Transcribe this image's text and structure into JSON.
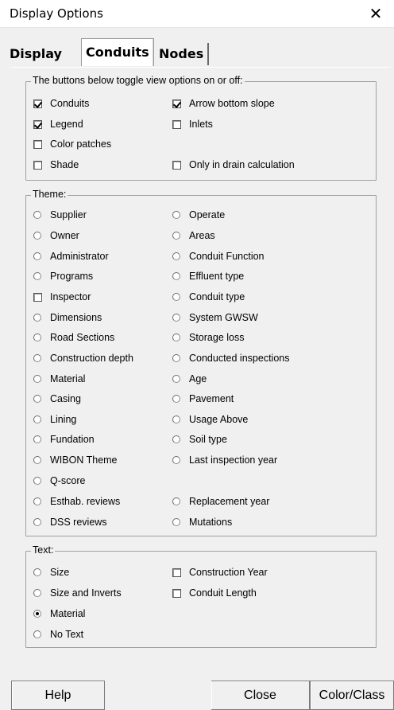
{
  "window": {
    "title": "Display Options",
    "close_glyph": "✕"
  },
  "tabs": [
    {
      "label": "Display",
      "active": false
    },
    {
      "label": "Conduits",
      "active": true
    },
    {
      "label": "Nodes",
      "active": false
    }
  ],
  "toggles": {
    "legend": "The buttons below toggle view options on or off:",
    "items": [
      {
        "label": "Conduits",
        "checked": true
      },
      {
        "label": "Arrow bottom slope",
        "checked": true
      },
      {
        "label": "Legend",
        "checked": true
      },
      {
        "label": "Inlets",
        "checked": false
      },
      {
        "label": "Color patches",
        "checked": false
      },
      {
        "label": "Shade",
        "checked": false
      },
      {
        "label": "Only in drain calculation",
        "checked": false
      }
    ]
  },
  "theme": {
    "legend": "Theme:",
    "items": [
      {
        "label": "Supplier",
        "kind": "radio"
      },
      {
        "label": "Operate",
        "kind": "radio"
      },
      {
        "label": "Owner",
        "kind": "radio"
      },
      {
        "label": "Areas",
        "kind": "radio"
      },
      {
        "label": "Administrator",
        "kind": "radio"
      },
      {
        "label": "Conduit Function",
        "kind": "radio"
      },
      {
        "label": "Programs",
        "kind": "radio"
      },
      {
        "label": "Effluent type",
        "kind": "radio"
      },
      {
        "label": "Inspector",
        "kind": "checkbox"
      },
      {
        "label": "Conduit type",
        "kind": "radio"
      },
      {
        "label": "Dimensions",
        "kind": "radio"
      },
      {
        "label": "System GWSW",
        "kind": "radio"
      },
      {
        "label": "Road Sections",
        "kind": "radio"
      },
      {
        "label": "Storage loss",
        "kind": "radio"
      },
      {
        "label": "Construction depth",
        "kind": "radio"
      },
      {
        "label": "Conducted inspections",
        "kind": "radio"
      },
      {
        "label": "Material",
        "kind": "radio"
      },
      {
        "label": "Age",
        "kind": "radio"
      },
      {
        "label": "Casing",
        "kind": "radio"
      },
      {
        "label": "Pavement",
        "kind": "radio"
      },
      {
        "label": "Lining",
        "kind": "radio"
      },
      {
        "label": "Usage Above",
        "kind": "radio"
      },
      {
        "label": "Fundation",
        "kind": "radio"
      },
      {
        "label": "Soil type",
        "kind": "radio"
      },
      {
        "label": "WIBON Theme",
        "kind": "radio"
      },
      {
        "label": "Last inspection year",
        "kind": "radio"
      },
      {
        "label": "Q-score",
        "kind": "radio"
      },
      {
        "label": "Esthab. reviews",
        "kind": "radio"
      },
      {
        "label": "Replacement year",
        "kind": "radio"
      },
      {
        "label": "DSS reviews",
        "kind": "radio"
      },
      {
        "label": "Mutations",
        "kind": "radio"
      }
    ]
  },
  "text": {
    "legend": "Text:",
    "items": [
      {
        "label": "Size",
        "kind": "radio",
        "selected": false
      },
      {
        "label": "Construction Year",
        "kind": "checkbox",
        "selected": false
      },
      {
        "label": "Size and Inverts",
        "kind": "radio",
        "selected": false
      },
      {
        "label": "Conduit Length",
        "kind": "checkbox",
        "selected": false
      },
      {
        "label": "Material",
        "kind": "radio",
        "selected": true
      },
      {
        "label": "No Text",
        "kind": "radio",
        "selected": false
      }
    ]
  },
  "buttons": {
    "help": "Help",
    "close": "Close",
    "color_class": "Color/Class"
  }
}
